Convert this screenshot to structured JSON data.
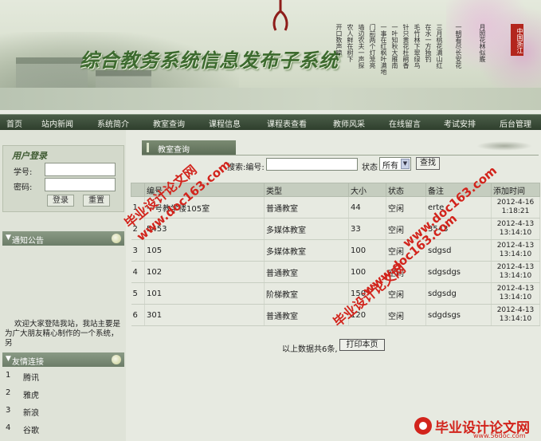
{
  "banner": {
    "title": "综合教务系统信息发布子系统",
    "seal": "中国浙江",
    "poem_columns": [
      "开口数声啼",
      "农人鲜在树下",
      "墙边农夫一声探",
      "门前两个灯笼亮",
      "一事在红枫叶满地",
      "一叶知秋大雁南",
      "针只黄花杜鹃香",
      "毛竹林下翠绿鸟",
      "在水一方独钓",
      "三月桃花满山红",
      "一朝看尽长安花",
      "月照花林似霰"
    ]
  },
  "nav": {
    "items": [
      "首页",
      "站内新闻",
      "系统简介",
      "教室查询",
      "课程信息",
      "课程表查看",
      "教师风采",
      "在线留言",
      "考试安排",
      "后台管理"
    ]
  },
  "login": {
    "heading": "用户登录",
    "username_label": "学号:",
    "password_label": "密码:",
    "login_button": "登录",
    "reset_button": "重置"
  },
  "notice": {
    "heading": "通知公告",
    "text": "欢迎大家登陆我站，我站主要是为广大朋友精心制作的一个系统，另"
  },
  "friend_links": {
    "heading": "友情连接",
    "items": [
      {
        "num": "1",
        "name": "腾讯"
      },
      {
        "num": "2",
        "name": "雅虎"
      },
      {
        "num": "3",
        "name": "新浪"
      },
      {
        "num": "4",
        "name": "谷歌"
      }
    ]
  },
  "main": {
    "tab_title": "教室查询",
    "search_label": "搜索:编号:",
    "search_value": "",
    "status_label": "状态",
    "status_selected": "所有",
    "search_button": "查找",
    "columns": [
      "编号",
      "类型",
      "大小",
      "状态",
      "备注",
      "添加时间"
    ],
    "rows": [
      {
        "idx": "1",
        "code": "一号教学楼105室",
        "type": "普通教室",
        "size": "44",
        "status": "空闲",
        "note": "erte",
        "date": "2012-4-16",
        "time": "1:18:21"
      },
      {
        "idx": "2",
        "code": "5453",
        "type": "多媒体教室",
        "size": "33",
        "status": "空闲",
        "note": "3543",
        "date": "2012-4-13",
        "time": "13:14:10"
      },
      {
        "idx": "3",
        "code": "105",
        "type": "多媒体教室",
        "size": "100",
        "status": "空闲",
        "note": "sdgsd",
        "date": "2012-4-13",
        "time": "13:14:10"
      },
      {
        "idx": "4",
        "code": "102",
        "type": "普通教室",
        "size": "100",
        "status": "空闲",
        "note": "sdgsdgs",
        "date": "2012-4-13",
        "time": "13:14:10"
      },
      {
        "idx": "5",
        "code": "101",
        "type": "阶梯教室",
        "size": "150",
        "status": "空闲",
        "note": "sdgsdg",
        "date": "2012-4-13",
        "time": "13:14:10"
      },
      {
        "idx": "6",
        "code": "301",
        "type": "普通教室",
        "size": "120",
        "status": "空闲",
        "note": "sdgdsgs",
        "date": "2012-4-13",
        "time": "13:14:10"
      }
    ],
    "summary": "以上数据共6条,",
    "print_button": "打印本页"
  },
  "watermarks": {
    "cn": "毕业设计论文网",
    "url": "www.doc163.com",
    "brand": "毕业设计论文网",
    "brand_url": "www.56doc.com"
  },
  "colors": {
    "nav_bg": "#2f3f2d",
    "watermark": "#d2241c",
    "title_green": "#3c6a2e"
  }
}
